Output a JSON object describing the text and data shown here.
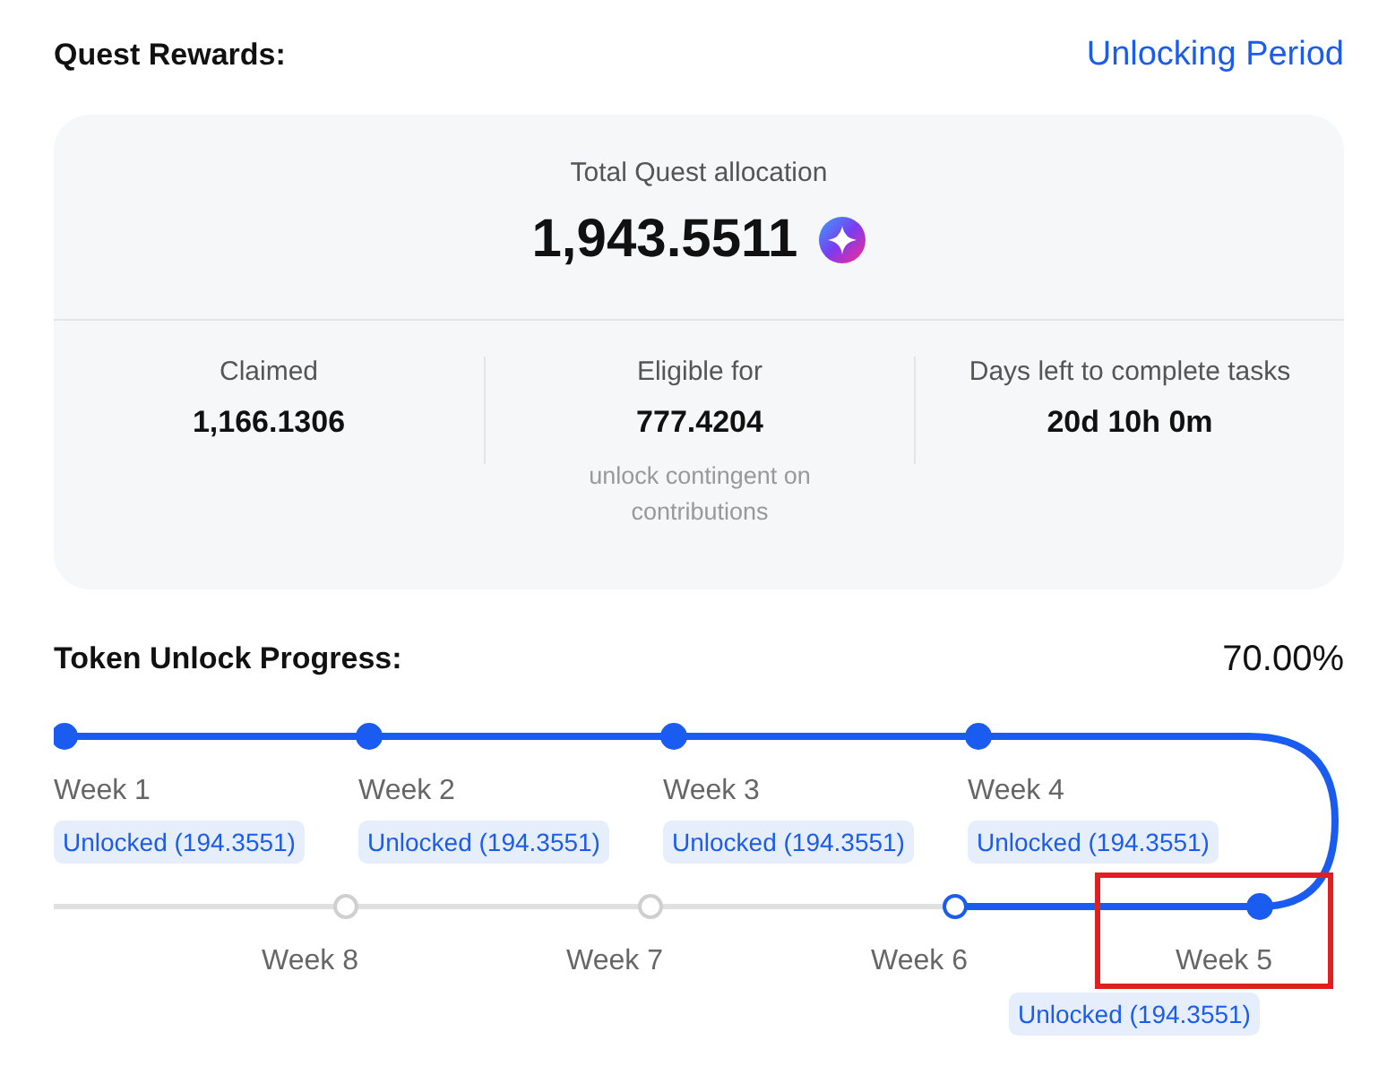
{
  "header": {
    "title": "Quest Rewards:",
    "link": "Unlocking Period"
  },
  "allocation": {
    "label": "Total Quest allocation",
    "value": "1,943.5511"
  },
  "stats": [
    {
      "label": "Claimed",
      "value": "1,166.1306"
    },
    {
      "label": "Eligible for",
      "value": "777.4204",
      "note": "unlock contingent on contributions"
    },
    {
      "label": "Days left to complete tasks",
      "value": "20d 10h 0m"
    }
  ],
  "progress": {
    "title": "Token Unlock Progress:",
    "percent": "70.00%"
  },
  "weeks": [
    {
      "label": "Week 1",
      "kind": "done",
      "badge": "Unlocked (194.3551)",
      "highlighted": false
    },
    {
      "label": "Week 2",
      "kind": "done",
      "badge": "Unlocked (194.3551)",
      "highlighted": false
    },
    {
      "label": "Week 3",
      "kind": "done",
      "badge": "Unlocked (194.3551)",
      "highlighted": false
    },
    {
      "label": "Week 4",
      "kind": "done",
      "badge": "Unlocked (194.3551)",
      "highlighted": false
    },
    {
      "label": "Week 8",
      "kind": "pending",
      "highlighted": false
    },
    {
      "label": "Week 7",
      "kind": "pending",
      "highlighted": false
    },
    {
      "label": "Week 6",
      "kind": "current",
      "highlighted": false
    },
    {
      "label": "Week 5",
      "kind": "done",
      "badge": "Unlocked (194.3551)",
      "highlighted": true
    }
  ]
}
